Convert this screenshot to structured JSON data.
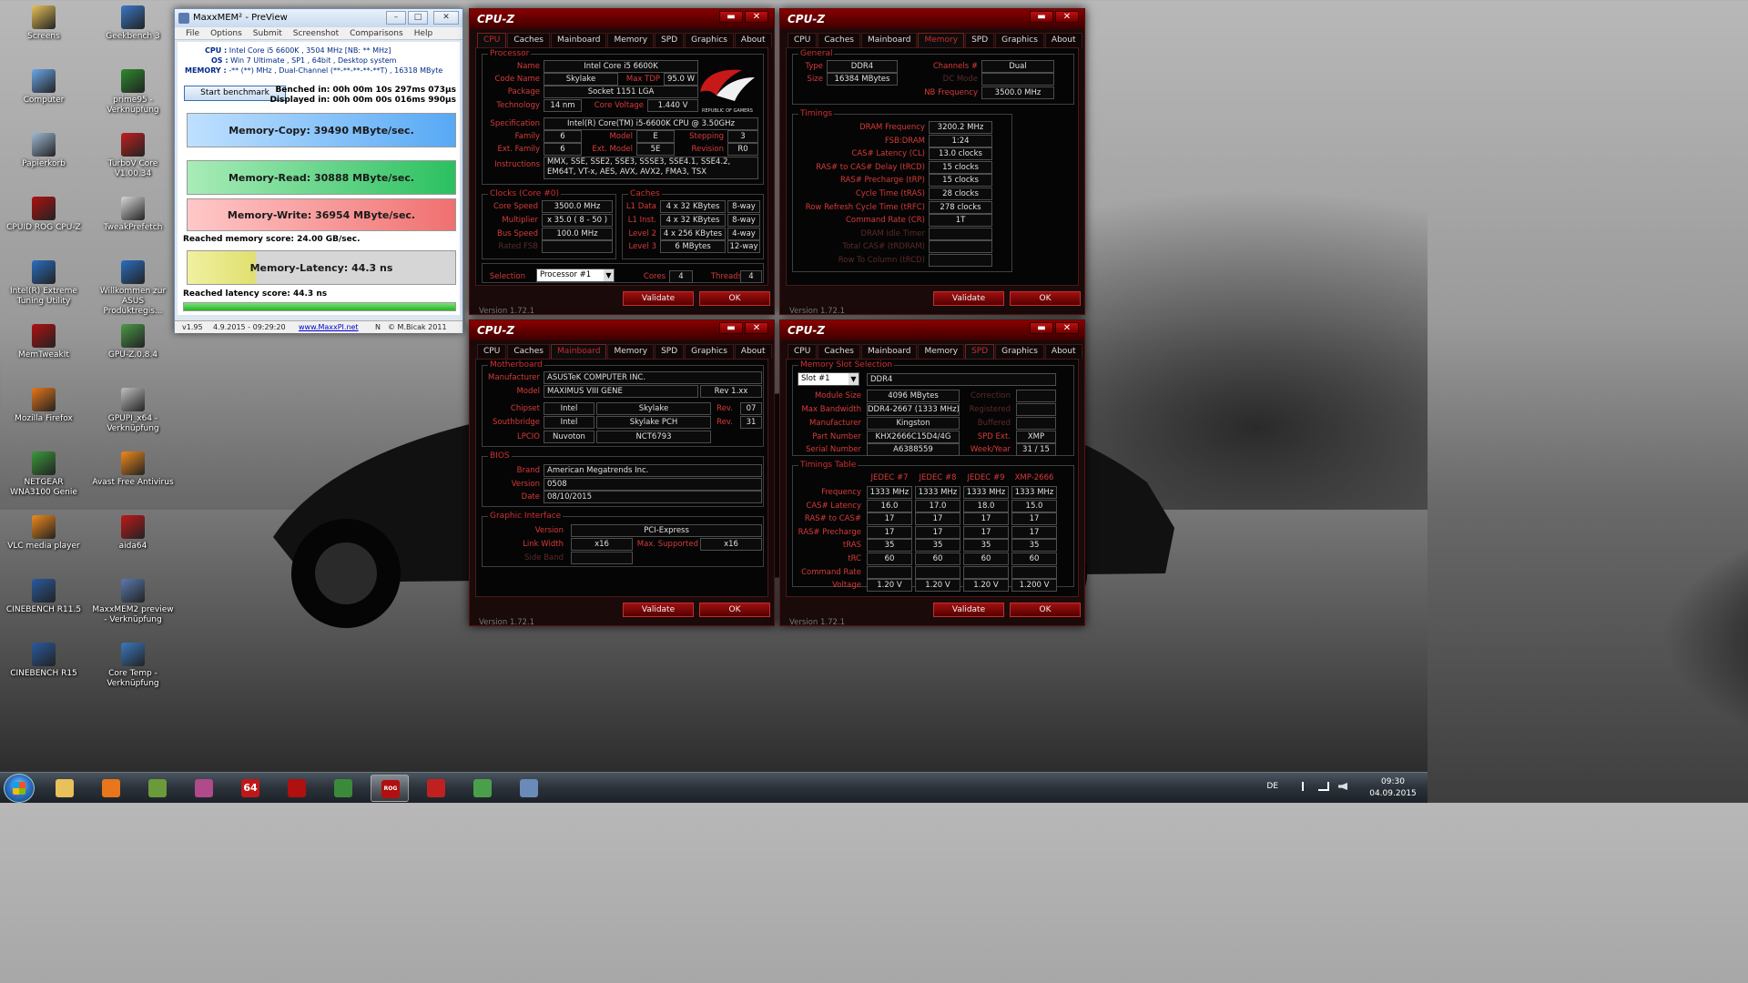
{
  "desktop": {
    "icons": [
      {
        "label": "Screens",
        "icon": "folder-icon",
        "color": "#e8c15a"
      },
      {
        "label": "Geekbench 3",
        "icon": "geekbench-icon",
        "color": "#3a78c8"
      },
      {
        "label": "Computer",
        "icon": "computer-icon",
        "color": "#6aa8e8"
      },
      {
        "label": "prime95 - Verknüpfung",
        "icon": "prime95-icon",
        "color": "#2e8b2e"
      },
      {
        "label": "Papierkorb",
        "icon": "recycle-bin-icon",
        "color": "#9fb9d4"
      },
      {
        "label": "TurboV Core V1.00.34",
        "icon": "turbov-icon",
        "color": "#c02020"
      },
      {
        "label": "CPUID ROG CPU-Z",
        "icon": "rog-cpuz-icon",
        "color": "#b01010"
      },
      {
        "label": "TweakPrefetch",
        "icon": "tweakprefetch-icon",
        "color": "#d8d8d8"
      },
      {
        "label": "Intel(R) Extreme Tuning Utility",
        "icon": "intel-xtu-icon",
        "color": "#2a6fc0"
      },
      {
        "label": "Willkommen zur ASUS Produktregis...",
        "icon": "asus-icon",
        "color": "#2a6fc0"
      },
      {
        "label": "MemTweakIt",
        "icon": "memtweakit-icon",
        "color": "#b01010"
      },
      {
        "label": "GPU-Z.0.8.4",
        "icon": "gpuz-icon",
        "color": "#4a9a4a"
      },
      {
        "label": "Mozilla Firefox",
        "icon": "firefox-icon",
        "color": "#e8761a"
      },
      {
        "label": "GPUPI_x64 - Verknüpfung",
        "icon": "gpupi-icon",
        "color": "#c0c0c0"
      },
      {
        "label": "NETGEAR WNA3100 Genie",
        "icon": "netgear-icon",
        "color": "#3b9a3b"
      },
      {
        "label": "Avast Free Antivirus",
        "icon": "avast-icon",
        "color": "#f08a1c"
      },
      {
        "label": "VLC media player",
        "icon": "vlc-icon",
        "color": "#f08a1c"
      },
      {
        "label": "aida64",
        "icon": "aida64-icon",
        "color": "#c01818"
      },
      {
        "label": "CINEBENCH R11.5",
        "icon": "cinebench-icon",
        "color": "#2a5aa0"
      },
      {
        "label": "MaxxMEM2 preview - Verknüpfung",
        "icon": "maxxmem-icon",
        "color": "#5a7ab0"
      },
      {
        "label": "CINEBENCH R15",
        "icon": "cinebench-icon",
        "color": "#2a5aa0"
      },
      {
        "label": "Core Temp - Verknüpfung",
        "icon": "coretemp-icon",
        "color": "#3a7ac0"
      }
    ]
  },
  "taskbar": {
    "items": [
      {
        "icon": "explorer-icon",
        "color": "#e8c15a"
      },
      {
        "icon": "firefox-icon",
        "color": "#e8761a"
      },
      {
        "icon": "gpuz-icon",
        "color": "#6a9a3a"
      },
      {
        "icon": "winrar-icon",
        "color": "#b04a8a"
      },
      {
        "icon": "aida64-icon",
        "color": "#c01818",
        "text": "64"
      },
      {
        "icon": "memtweakit-icon",
        "color": "#b01010"
      },
      {
        "icon": "gpu-tool-icon",
        "color": "#3b8a3b"
      },
      {
        "icon": "rog-cpuz-icon",
        "color": "#b01010",
        "text": "ROG CPUZ"
      },
      {
        "icon": "turbov-icon",
        "color": "#c02020"
      },
      {
        "icon": "snipping-icon",
        "color": "#4aa04a"
      },
      {
        "icon": "maxxmem-icon",
        "color": "#6a8ab8"
      }
    ],
    "language": "DE",
    "time": "09:30",
    "date": "04.09.2015"
  },
  "maxxmem": {
    "title": "MaxxMEM² - PreView",
    "menu": [
      "File",
      "Options",
      "Submit",
      "Screenshot",
      "Comparisons",
      "Help"
    ],
    "cpu_label": "CPU :",
    "cpu_value": "Intel Core i5 6600K , 3504 MHz  [NB: ** MHz]",
    "os_label": "OS :",
    "os_value": "Win 7 Ultimate , SP1 , 64bit , Desktop system",
    "memory_label": "MEMORY :",
    "memory_value": "-** (**) MHz , Dual-Channel (**-**-**-**-**T) , 16318 MByte",
    "start_button": "Start benchmark",
    "benched": "Benched in: 00h 00m 10s 297ms 073µs",
    "displayed": "Displayed in: 00h 00m 00s 016ms 990µs",
    "copy": "Memory-Copy: 39490 MByte/sec.",
    "read": "Memory-Read: 30888 MByte/sec.",
    "write": "Memory-Write: 36954 MByte/sec.",
    "memory_score": "Reached memory score: 24.00 GB/sec.",
    "latency": "Memory-Latency: 44.3 ns",
    "latency_score": "Reached latency score: 44.3 ns",
    "version": "v1.95",
    "datetime": "4.9.2015 - 09:29:20",
    "link": "www.MaxxPI.net",
    "n": "N",
    "copyright": "© M.Bicak 2011"
  },
  "cpuz_common": {
    "title": "CPU-Z",
    "tabs": [
      "CPU",
      "Caches",
      "Mainboard",
      "Memory",
      "SPD",
      "Graphics",
      "About"
    ],
    "validate": "Validate",
    "ok": "OK",
    "version": "Version 1.72.1",
    "minimize": "▬",
    "close": "✕",
    "rog_caption": "REPUBLIC OF GAMERS"
  },
  "cpu_tab": {
    "processor_group": "Processor",
    "name_l": "Name",
    "name": "Intel Core i5 6600K",
    "codename_l": "Code Name",
    "codename": "Skylake",
    "maxtdp_l": "Max TDP",
    "maxtdp": "95.0 W",
    "package_l": "Package",
    "package": "Socket 1151 LGA",
    "technology_l": "Technology",
    "technology": "14 nm",
    "corevoltage_l": "Core Voltage",
    "corevoltage": "1.440 V",
    "spec_l": "Specification",
    "spec": "Intel(R) Core(TM) i5-6600K CPU @ 3.50GHz",
    "family_l": "Family",
    "family": "6",
    "model_l": "Model",
    "model": "E",
    "stepping_l": "Stepping",
    "stepping": "3",
    "extfamily_l": "Ext. Family",
    "extfamily": "6",
    "extmodel_l": "Ext. Model",
    "extmodel": "5E",
    "revision_l": "Revision",
    "revision": "R0",
    "instructions_l": "Instructions",
    "instructions": "MMX, SSE, SSE2, SSE3, SSSE3, SSE4.1, SSE4.2, EM64T, VT-x, AES, AVX, AVX2, FMA3, TSX",
    "clocks_group": "Clocks (Core #0)",
    "corespeed_l": "Core Speed",
    "corespeed": "3500.0 MHz",
    "multiplier_l": "Multiplier",
    "multiplier": "x 35.0 ( 8 - 50 )",
    "busspeed_l": "Bus Speed",
    "busspeed": "100.0 MHz",
    "ratedfsb_l": "Rated FSB",
    "ratedfsb": "",
    "caches_group": "Caches",
    "l1d_l": "L1 Data",
    "l1d": "4 x 32 KBytes",
    "l1d_w": "8-way",
    "l1i_l": "L1 Inst.",
    "l1i": "4 x 32 KBytes",
    "l1i_w": "8-way",
    "l2_l": "Level 2",
    "l2": "4 x 256 KBytes",
    "l2_w": "4-way",
    "l3_l": "Level 3",
    "l3": "6 MBytes",
    "l3_w": "12-way",
    "selection_l": "Selection",
    "selection": "Processor #1",
    "cores_l": "Cores",
    "cores": "4",
    "threads_l": "Threads",
    "threads": "4"
  },
  "memory_tab": {
    "general_group": "General",
    "type_l": "Type",
    "type": "DDR4",
    "channels_l": "Channels #",
    "channels": "Dual",
    "size_l": "Size",
    "size": "16384 MBytes",
    "dcmode_l": "DC Mode",
    "dcmode": "",
    "nbfreq_l": "NB Frequency",
    "nbfreq": "3500.0 MHz",
    "timings_group": "Timings",
    "rows": [
      {
        "l": "DRAM Frequency",
        "v": "3200.2 MHz",
        "dim": false
      },
      {
        "l": "FSB:DRAM",
        "v": "1:24",
        "dim": false
      },
      {
        "l": "CAS# Latency (CL)",
        "v": "13.0 clocks",
        "dim": false
      },
      {
        "l": "RAS# to CAS# Delay (tRCD)",
        "v": "15 clocks",
        "dim": false
      },
      {
        "l": "RAS# Precharge (tRP)",
        "v": "15 clocks",
        "dim": false
      },
      {
        "l": "Cycle Time (tRAS)",
        "v": "28 clocks",
        "dim": false
      },
      {
        "l": "Row Refresh Cycle Time (tRFC)",
        "v": "278 clocks",
        "dim": false
      },
      {
        "l": "Command Rate (CR)",
        "v": "1T",
        "dim": false
      },
      {
        "l": "DRAM Idle Timer",
        "v": "",
        "dim": true
      },
      {
        "l": "Total CAS# (tRDRAM)",
        "v": "",
        "dim": true
      },
      {
        "l": "Row To Column (tRCD)",
        "v": "",
        "dim": true
      }
    ]
  },
  "mainboard_tab": {
    "motherboard_group": "Motherboard",
    "manufacturer_l": "Manufacturer",
    "manufacturer": "ASUSTeK COMPUTER INC.",
    "model_l": "Model",
    "model": "MAXIMUS VIII GENE",
    "model_rev": "Rev 1.xx",
    "chipset_l": "Chipset",
    "chipset": "Intel",
    "chipset2": "Skylake",
    "chipset_rev_l": "Rev.",
    "chipset_rev": "07",
    "southbridge_l": "Southbridge",
    "southbridge": "Intel",
    "southbridge2": "Skylake PCH",
    "southbridge_rev_l": "Rev.",
    "southbridge_rev": "31",
    "lpcio_l": "LPCIO",
    "lpcio": "Nuvoton",
    "lpcio2": "NCT6793",
    "bios_group": "BIOS",
    "brand_l": "Brand",
    "brand": "American Megatrends Inc.",
    "version_l": "Version",
    "version": "0508",
    "date_l": "Date",
    "date": "08/10/2015",
    "gi_group": "Graphic Interface",
    "gi_version_l": "Version",
    "gi_version": "PCI-Express",
    "linkwidth_l": "Link Width",
    "linkwidth": "x16",
    "maxsupported_l": "Max. Supported",
    "maxsupported": "x16",
    "sideband_l": "Side Band",
    "sideband": ""
  },
  "spd_tab": {
    "slot_group": "Memory Slot Selection",
    "slot": "Slot #1",
    "type": "DDR4",
    "modulesize_l": "Module Size",
    "modulesize": "4096 MBytes",
    "correction_l": "Correction",
    "maxbw_l": "Max Bandwidth",
    "maxbw": "DDR4-2667 (1333 MHz)",
    "registered_l": "Registered",
    "manufacturer_l": "Manufacturer",
    "manufacturer": "Kingston",
    "buffered_l": "Buffered",
    "partnumber_l": "Part Number",
    "partnumber": "KHX2666C15D4/4G",
    "spdext_l": "SPD Ext.",
    "spdext": "XMP",
    "serial_l": "Serial Number",
    "serial": "A6388559",
    "weekyear_l": "Week/Year",
    "weekyear": "31 / 15",
    "timings_group": "Timings Table",
    "cols": [
      "JEDEC #7",
      "JEDEC #8",
      "JEDEC #9",
      "XMP-2666"
    ],
    "rows": [
      {
        "l": "Frequency",
        "v": [
          "1333 MHz",
          "1333 MHz",
          "1333 MHz",
          "1333 MHz"
        ]
      },
      {
        "l": "CAS# Latency",
        "v": [
          "16.0",
          "17.0",
          "18.0",
          "15.0"
        ]
      },
      {
        "l": "RAS# to CAS#",
        "v": [
          "17",
          "17",
          "17",
          "17"
        ]
      },
      {
        "l": "RAS# Precharge",
        "v": [
          "17",
          "17",
          "17",
          "17"
        ]
      },
      {
        "l": "tRAS",
        "v": [
          "35",
          "35",
          "35",
          "35"
        ]
      },
      {
        "l": "tRC",
        "v": [
          "60",
          "60",
          "60",
          "60"
        ]
      },
      {
        "l": "Command Rate",
        "v": [
          "",
          "",
          "",
          ""
        ]
      },
      {
        "l": "Voltage",
        "v": [
          "1.20 V",
          "1.20 V",
          "1.20 V",
          "1.200 V"
        ]
      }
    ]
  }
}
